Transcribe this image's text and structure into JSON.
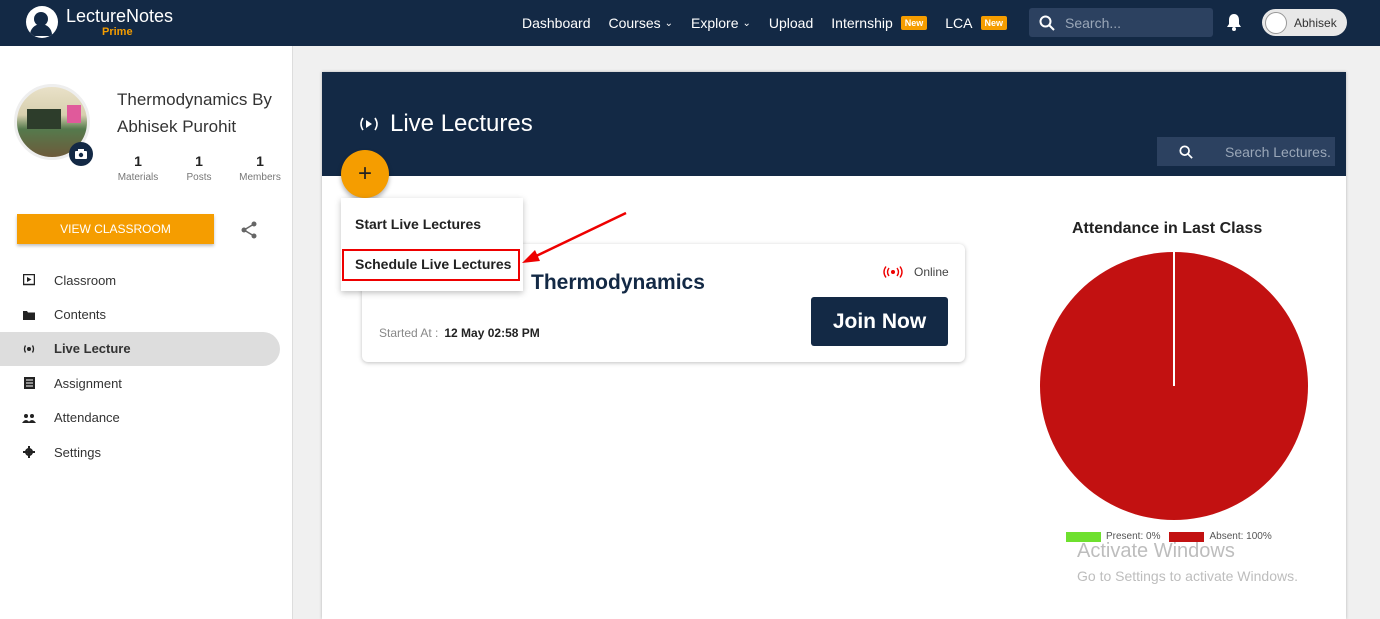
{
  "app": {
    "name": "LectureNotes",
    "tier": "Prime"
  },
  "nav": {
    "links": [
      {
        "label": "Dashboard"
      },
      {
        "label": "Courses",
        "dropdown": true
      },
      {
        "label": "Explore",
        "dropdown": true
      },
      {
        "label": "Upload"
      },
      {
        "label": "Internship",
        "badge": "New"
      },
      {
        "label": "LCA",
        "badge": "New"
      }
    ],
    "search_placeholder": "Search...",
    "user_name": "Abhisek"
  },
  "sidebar": {
    "class_title": "Thermodynamics By Abhisek Purohit",
    "stats": [
      {
        "value": "1",
        "label": "Materials"
      },
      {
        "value": "1",
        "label": "Posts"
      },
      {
        "value": "1",
        "label": "Members"
      }
    ],
    "view_button": "VIEW CLASSROOM",
    "menu": [
      {
        "label": "Classroom",
        "icon": "classroom-icon",
        "active": false
      },
      {
        "label": "Contents",
        "icon": "folder-icon",
        "active": false
      },
      {
        "label": "Live Lecture",
        "icon": "live-icon",
        "active": true
      },
      {
        "label": "Assignment",
        "icon": "assignment-icon",
        "active": false
      },
      {
        "label": "Attendance",
        "icon": "people-icon",
        "active": false
      },
      {
        "label": "Settings",
        "icon": "gear-icon",
        "active": false
      }
    ]
  },
  "main": {
    "title": "Live Lectures",
    "search_placeholder": "Search Lectures.",
    "fab_label": "+",
    "dropdown": [
      {
        "label": "Start Live Lectures"
      },
      {
        "label": "Schedule Live Lectures",
        "highlighted": true
      }
    ],
    "lecture": {
      "name": "Thermodynamics",
      "status": "Online",
      "started_label": "Started At :",
      "started_value": "12 May 02:58 PM",
      "join_label": "Join Now"
    }
  },
  "attendance": {
    "title": "Attendance in Last Class",
    "present_label": "Present: 0%",
    "absent_label": "Absent: 100%"
  },
  "chart_data": {
    "type": "pie",
    "title": "Attendance in Last Class",
    "categories": [
      "Present",
      "Absent"
    ],
    "values": [
      0,
      100
    ],
    "colors": [
      "#6ee02e",
      "#c21111"
    ],
    "legend": "bottom"
  },
  "watermark": {
    "line1": "Activate Windows",
    "line2": "Go to Settings to activate Windows."
  },
  "colors": {
    "nav": "#132945",
    "accent": "#f59d00",
    "absent": "#c21111",
    "present": "#6ee02e",
    "highlight": "#e00000"
  }
}
